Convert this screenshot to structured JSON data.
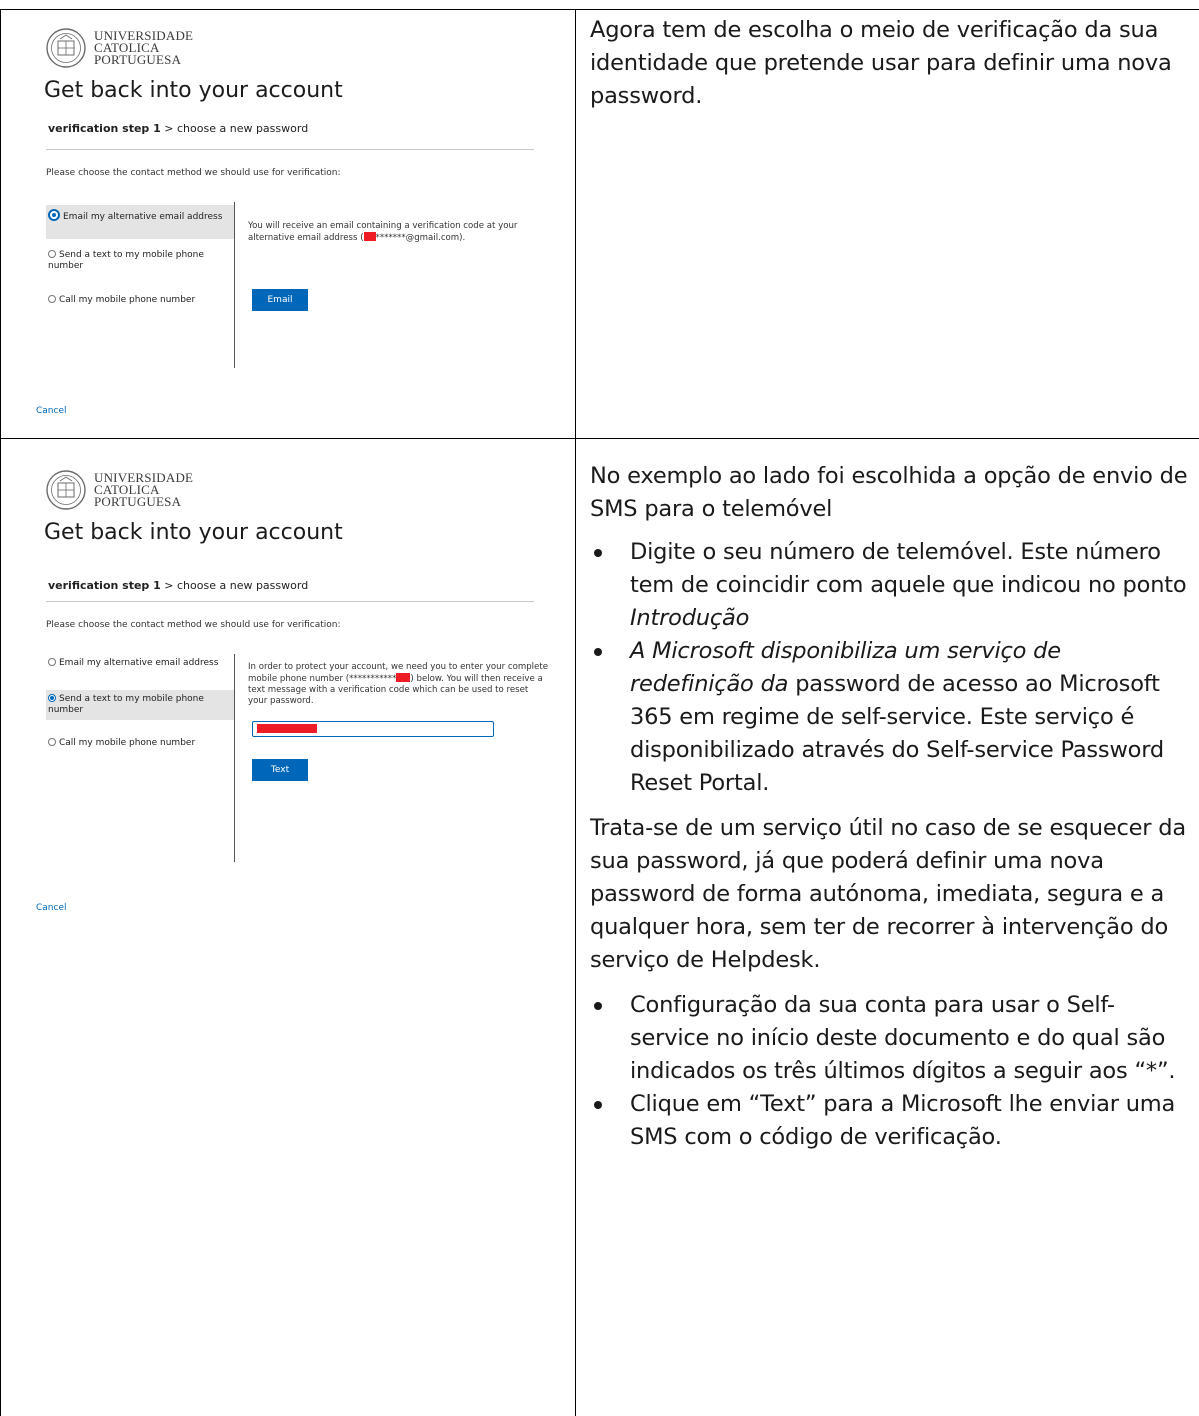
{
  "logo": {
    "line1": "UNIVERSIDADE",
    "line2": "CATOLICA",
    "line3": "PORTUGUESA"
  },
  "shot1": {
    "title": "Get back into your account",
    "crumb_step": "verification step 1",
    "crumb_rest": " > choose a new password",
    "prompt": "Please choose the contact method we should use for verification:",
    "options": [
      "Email my alternative email address",
      "Send a text to my mobile phone number",
      "Call my mobile phone number"
    ],
    "selected_index": 0,
    "desc_before": "You will receive an email containing a verification code at your alternative email address (",
    "desc_masked": "*******@gmail.com).",
    "button": "Email",
    "cancel": "Cancel"
  },
  "shot2": {
    "title": "Get back into your account",
    "crumb_step": "verification step 1",
    "crumb_rest": " > choose a new password",
    "prompt": "Please choose the contact method we should use for verification:",
    "options": [
      "Email my alternative email address",
      "Send a text to my mobile phone number",
      "Call my mobile phone number"
    ],
    "selected_index": 1,
    "desc_before": "In order to protect your account, we need you to enter your complete mobile phone number (***********",
    "desc_after": ") below. You will then receive a text message with a verification code which can be used to reset your password.",
    "button": "Text",
    "cancel": "Cancel"
  },
  "right1": {
    "text": "Agora tem de escolha o meio de verificação da sua identidade que pretende usar para definir uma nova password."
  },
  "right2": {
    "intro": "No exemplo ao lado foi escolhida a opção de envio de SMS para o telemóvel",
    "b1_text": "Digite o seu número de telemóvel. Este número tem de coincidir com aquele que indicou no ponto ",
    "b1_italic": "Introdução",
    "b2_italic": "A Microsoft disponibiliza um serviço de redefinição da",
    "b2_text": " password de acesso ao Microsoft 365 em regime de self-service. Este serviço é disponibilizado através do Self-service Password Reset Portal.",
    "para": "Trata-se de um serviço útil no caso de se esquecer da sua password, já que poderá definir uma nova password de forma autónoma, imediata, segura e a qualquer hora, sem ter de recorrer à intervenção do serviço de Helpdesk.",
    "b3": "Configuração da sua conta para usar o Self-service no início deste documento e do qual são indicados os três últimos dígitos a seguir aos “*”.",
    "b4": "Clique em “Text” para a Microsoft lhe enviar uma SMS com o código de verificação."
  }
}
